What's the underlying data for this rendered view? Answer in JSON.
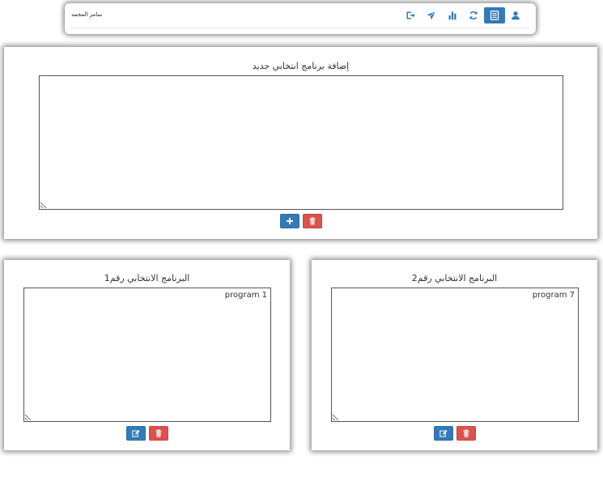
{
  "header": {
    "username": "سامر المحمد",
    "icons": [
      "logout-icon",
      "send-icon",
      "bar-chart-icon",
      "refresh-icon",
      "list-icon",
      "user-icon"
    ],
    "active_icon": "list-icon"
  },
  "new_program": {
    "title": "إضافة برنامج انتخابي جديد",
    "text": "",
    "add_icon": "plus-icon",
    "delete_icon": "trash-icon"
  },
  "programs": [
    {
      "title": "البرنامج الانتخابي رقم1",
      "text": "program 1",
      "edit_icon": "edit-icon",
      "delete_icon": "trash-icon"
    },
    {
      "title": "البرنامج الانتخابي رقم2",
      "text": "program 7",
      "edit_icon": "edit-icon",
      "delete_icon": "trash-icon"
    }
  ],
  "colors": {
    "primary": "#337ab7",
    "danger": "#d9534f"
  }
}
